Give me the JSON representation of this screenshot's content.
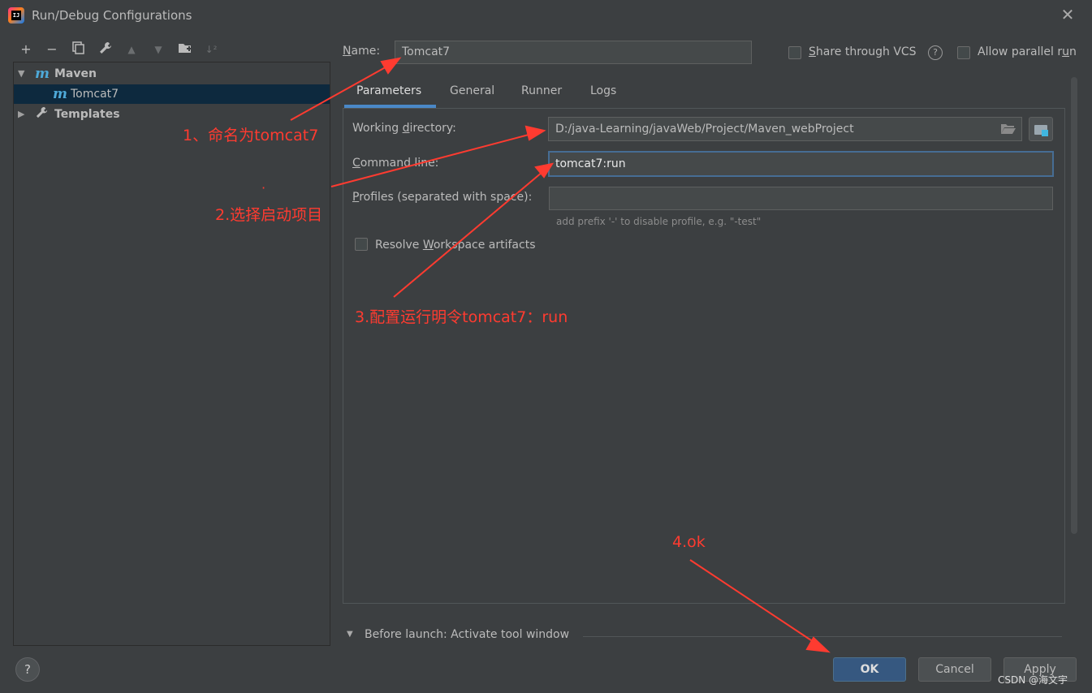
{
  "window": {
    "title": "Run/Debug Configurations",
    "app_icon_text": "IJ"
  },
  "toolbar": {
    "add": "+",
    "remove": "−",
    "copy": "⧉",
    "edit": "🔧",
    "up": "▲",
    "down": "▼",
    "folder": "📁",
    "sort": "↓²"
  },
  "tree": {
    "maven_label": "Maven",
    "tomcat_label": "Tomcat7",
    "templates_label": "Templates",
    "m_glyph": "m"
  },
  "form": {
    "name_label_rest": "ame:",
    "name_label_mnemonic": "N",
    "name_value": "Tomcat7",
    "share_vcs_mnemonic": "S",
    "share_vcs_rest": "hare through VCS",
    "help_glyph": "?",
    "parallel_pre": "Allow parallel r",
    "parallel_mnemonic": "u",
    "parallel_post": "n"
  },
  "tabs": {
    "parameters": "Parameters",
    "general": "General",
    "runner": "Runner",
    "logs": "Logs"
  },
  "params": {
    "wd_label_pre": "Working ",
    "wd_label_mnemonic": "d",
    "wd_label_post": "irectory:",
    "wd_value": "D:/java-Learning/javaWeb/Project/Maven_webProject",
    "cmd_label_mnemonic": "C",
    "cmd_label_rest": "ommand line:",
    "cmd_value": "tomcat7:run",
    "profiles_label_mnemonic": "P",
    "profiles_label_rest": "rofiles (separated with space):",
    "profiles_hint": "add prefix '-' to disable profile, e.g. \"-test\"",
    "resolve_pre": "Resolve ",
    "resolve_mnemonic": "W",
    "resolve_post": "orkspace artifacts"
  },
  "before_launch": {
    "label": "Before launch: Activate tool window"
  },
  "buttons": {
    "help": "?",
    "ok": "OK",
    "cancel": "Cancel",
    "apply": "Apply"
  },
  "watermark": "CSDN @海文宇",
  "annotations": {
    "step1": "1、命名为tomcat7",
    "step2": "2.选择启动项目",
    "step3": "3.配置运行明令tomcat7：run",
    "step4": "4.ok",
    "dot": "·",
    "color": "#ff3b30"
  }
}
